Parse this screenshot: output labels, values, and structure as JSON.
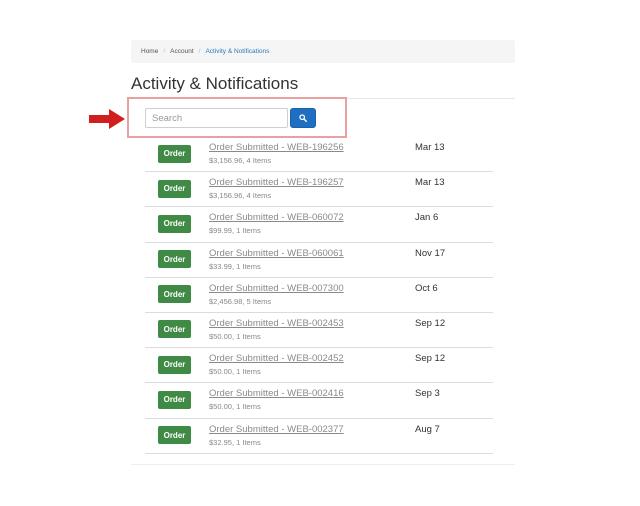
{
  "breadcrumb": {
    "items": [
      "Home",
      "Account"
    ],
    "separator": "/",
    "active": "Activity & Notifications"
  },
  "page_title": "Activity & Notifications",
  "search": {
    "placeholder": "Search",
    "value": "",
    "button_icon": "search-icon"
  },
  "annotation": {
    "arrow_color": "#d11f1f",
    "highlight_color": "#e8a0a0"
  },
  "colors": {
    "badge_green": "#3f8a44",
    "button_blue": "#1e6fc2",
    "link_blue": "#2a7ab8"
  },
  "activities": [
    {
      "badge": "Order",
      "title": "Order Submitted - WEB-196256",
      "subtitle": "$3,156.96, 4 Items",
      "date": "Mar 13"
    },
    {
      "badge": "Order",
      "title": "Order Submitted - WEB-196257",
      "subtitle": "$3,156.96, 4 Items",
      "date": "Mar 13"
    },
    {
      "badge": "Order",
      "title": "Order Submitted - WEB-060072",
      "subtitle": "$99.99, 1 Items",
      "date": "Jan 6"
    },
    {
      "badge": "Order",
      "title": "Order Submitted - WEB-060061",
      "subtitle": "$33.99, 1 Items",
      "date": "Nov 17"
    },
    {
      "badge": "Order",
      "title": "Order Submitted - WEB-007300",
      "subtitle": "$2,456.98, 5 Items",
      "date": "Oct 6"
    },
    {
      "badge": "Order",
      "title": "Order Submitted - WEB-002453",
      "subtitle": "$50.00, 1 Items",
      "date": "Sep 12"
    },
    {
      "badge": "Order",
      "title": "Order Submitted - WEB-002452",
      "subtitle": "$50.00, 1 Items",
      "date": "Sep 12"
    },
    {
      "badge": "Order",
      "title": "Order Submitted - WEB-002416",
      "subtitle": "$50.00, 1 Items",
      "date": "Sep 3"
    },
    {
      "badge": "Order",
      "title": "Order Submitted - WEB-002377",
      "subtitle": "$32.95, 1 Items",
      "date": "Aug 7"
    }
  ]
}
